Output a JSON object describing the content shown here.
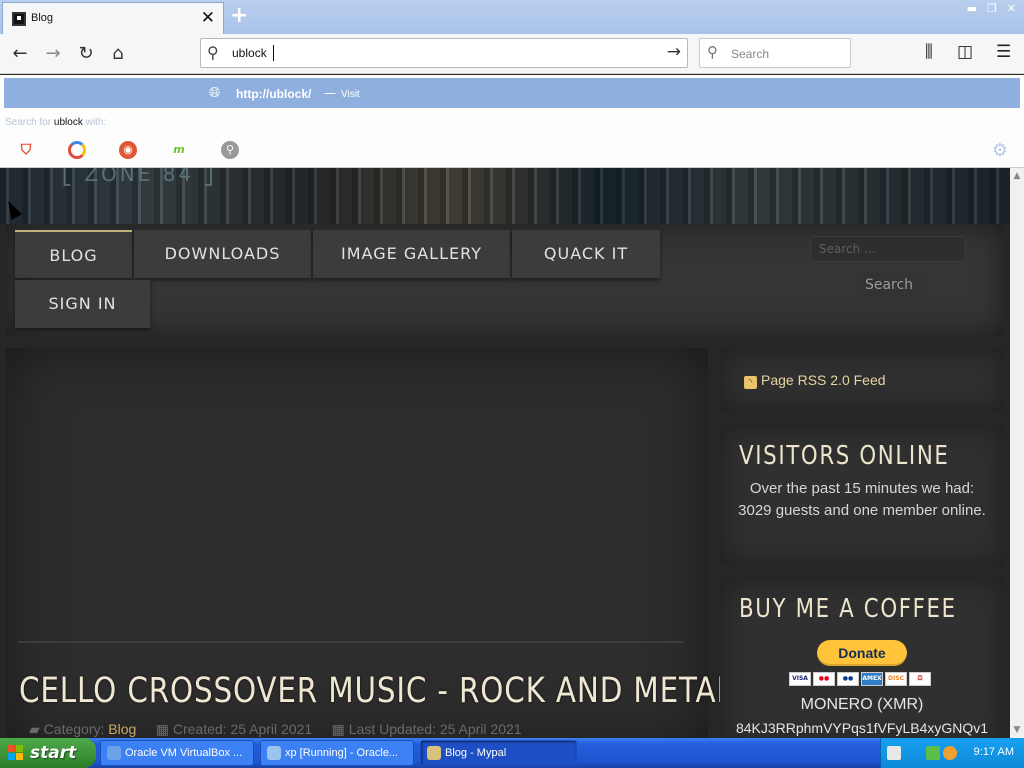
{
  "browser": {
    "tab": {
      "title": "Blog"
    },
    "urlbar": {
      "value": "ublock"
    },
    "searchbar": {
      "placeholder": "Search"
    },
    "autocomplete": {
      "url_text": "http://ublock/",
      "dash": "—",
      "visit": "Visit",
      "search_for_prefix": "Search for",
      "search_for_query": "ublock",
      "search_for_suffix": "with:"
    }
  },
  "page": {
    "menu": {
      "blog": "BLOG",
      "downloads": "DOWNLOADS",
      "image_gallery": "IMAGE GALLERY",
      "quack_it": "QUACK IT",
      "sign_in": "SIGN IN"
    },
    "site_search": {
      "placeholder": "Search ...",
      "button": "Search"
    },
    "article": {
      "title": "CELLO CROSSOVER MUSIC - ROCK AND METAL",
      "category_label": "Category:",
      "category_value": "Blog",
      "created": "Created: 25 April 2021",
      "updated": "Last Updated: 25 April 2021"
    },
    "sidebar": {
      "rss": "Page RSS 2.0 Feed",
      "visitors_title": "VISITORS ONLINE",
      "visitors_text": "Over the past 15 minutes we had: 3029 guests and one member online.",
      "coffee_title": "BUY ME A COFFEE",
      "donate": "Donate",
      "monero_label": "MONERO (XMR)",
      "monero_address": "84KJ3RRphmVYPqs1fVFyLB4xyGNQv1"
    }
  },
  "taskbar": {
    "start": "start",
    "tasks": {
      "virtualbox": "Oracle VM VirtualBox ...",
      "xp_running": "xp [Running] - Oracle...",
      "blog": "Blog - Mypal"
    },
    "clock": "9:17 AM"
  },
  "colors": {
    "accent_gold": "#c9a96a",
    "donate_yellow": "#ffc439",
    "autocomplete_highlight": "#8fb0de",
    "taskbar_blue": "#245edb",
    "start_green": "#3a9136"
  }
}
